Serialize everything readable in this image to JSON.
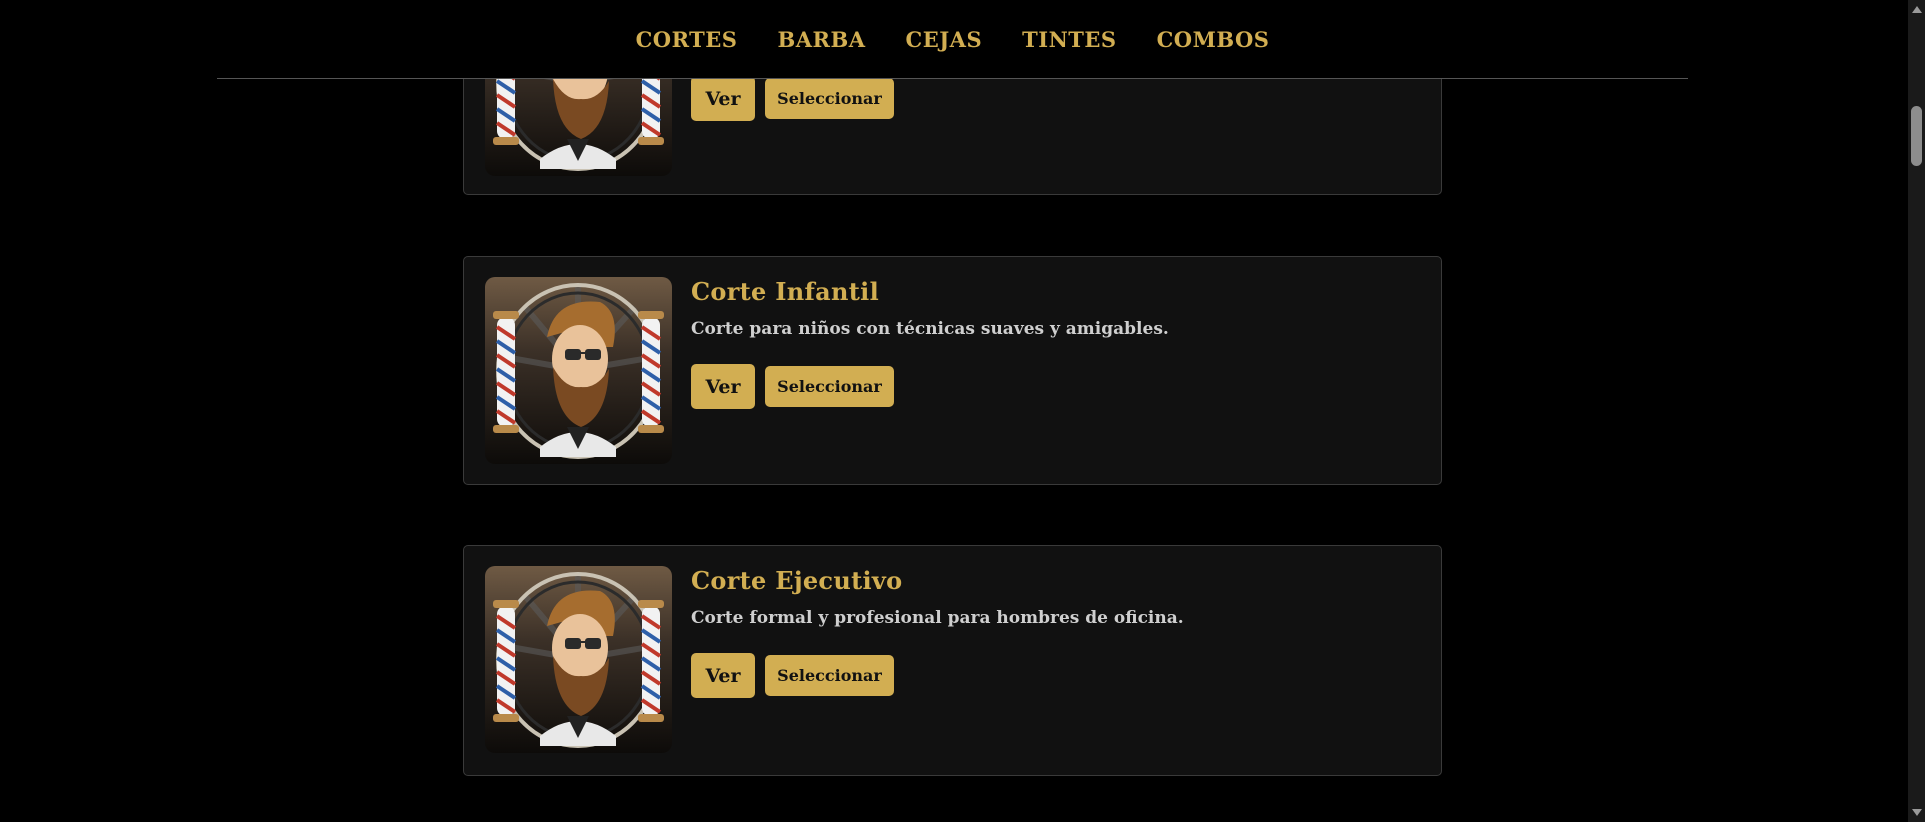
{
  "nav": {
    "items": [
      "CORTES",
      "BARBA",
      "CEJAS",
      "TINTES",
      "COMBOS"
    ]
  },
  "cards": [
    {
      "title": "",
      "description": "",
      "ver_label": "Ver",
      "select_label": "Seleccionar",
      "image_icon": "barber-logo-icon"
    },
    {
      "title": "Corte Infantil",
      "description": "Corte para niños con técnicas suaves y amigables.",
      "ver_label": "Ver",
      "select_label": "Seleccionar",
      "image_icon": "barber-logo-icon"
    },
    {
      "title": "Corte Ejecutivo",
      "description": "Corte formal y profesional para hombres de oficina.",
      "ver_label": "Ver",
      "select_label": "Seleccionar",
      "image_icon": "barber-logo-icon"
    }
  ],
  "colors": {
    "accent": "#d2ae52",
    "background": "#000000",
    "card": "#111111",
    "text": "#cfcfcf"
  }
}
